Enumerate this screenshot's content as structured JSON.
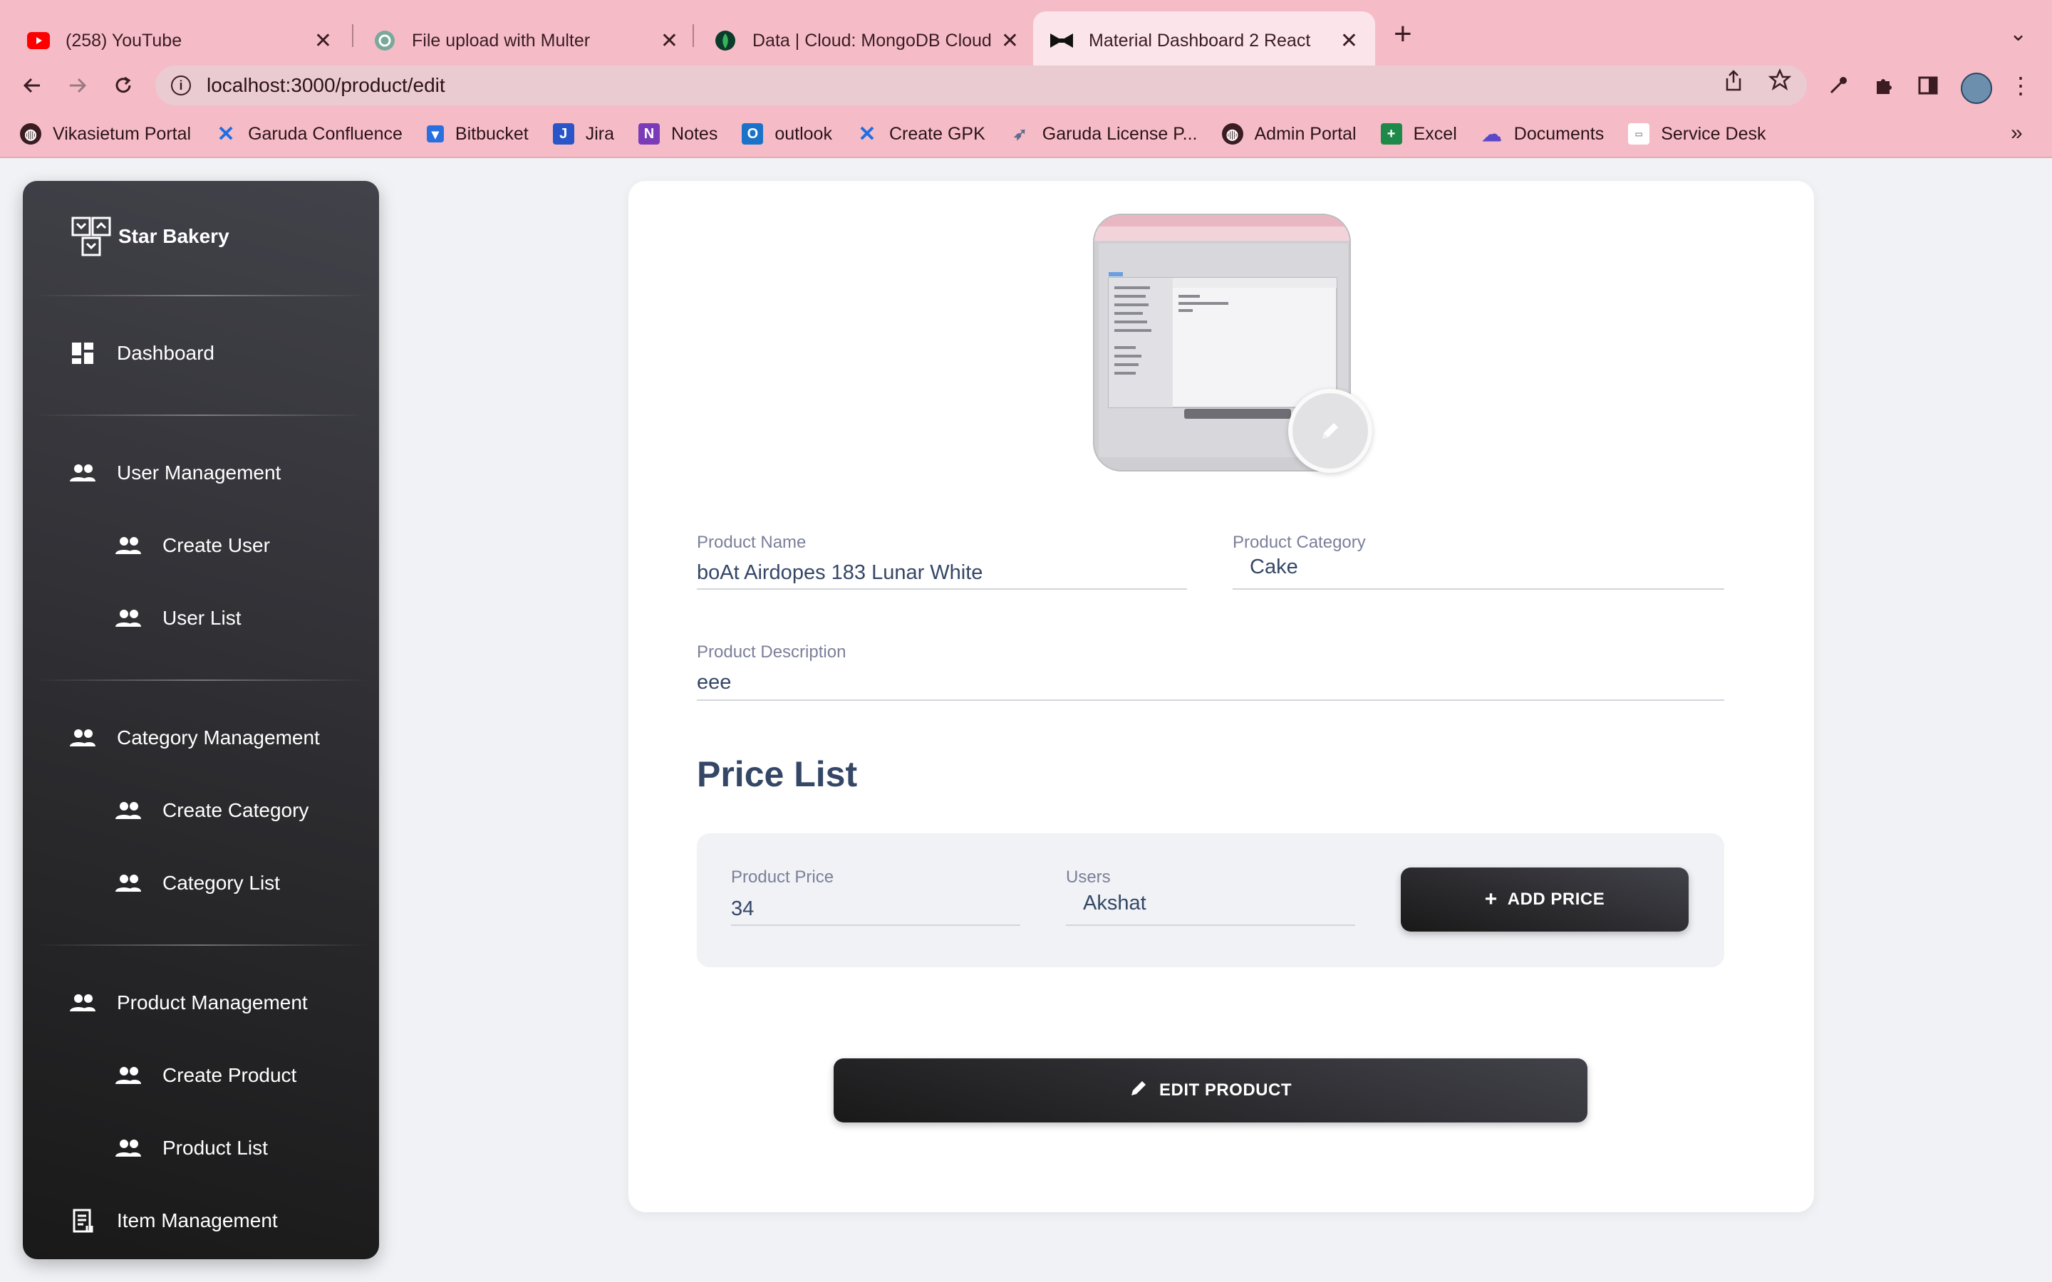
{
  "browser": {
    "tabs": [
      {
        "title": "(258) YouTube",
        "icon": "youtube-icon",
        "active": false
      },
      {
        "title": "File upload with Multer",
        "icon": "chatgpt-icon",
        "active": false
      },
      {
        "title": "Data | Cloud: MongoDB Cloud",
        "icon": "mongodb-leaf-icon",
        "active": false
      },
      {
        "title": "Material Dashboard 2 React",
        "icon": "bow-tie-icon",
        "active": true
      }
    ],
    "url": "localhost:3000/product/edit",
    "bookmarks": [
      {
        "label": "Vikasietum Portal",
        "icon": "globe-icon"
      },
      {
        "label": "Garuda Confluence",
        "icon": "confluence-icon"
      },
      {
        "label": "Bitbucket",
        "icon": "bitbucket-icon"
      },
      {
        "label": "Jira",
        "icon": "jira-icon"
      },
      {
        "label": "Notes",
        "icon": "onenote-icon"
      },
      {
        "label": "outlook",
        "icon": "outlook-icon"
      },
      {
        "label": "Create GPK",
        "icon": "confluence-icon"
      },
      {
        "label": "Garuda License P...",
        "icon": "paper-plane-icon"
      },
      {
        "label": "Admin Portal",
        "icon": "globe-icon"
      },
      {
        "label": "Excel",
        "icon": "excel-icon"
      },
      {
        "label": "Documents",
        "icon": "cloud-docs-icon"
      },
      {
        "label": "Service Desk",
        "icon": "service-desk-icon"
      }
    ]
  },
  "sidebar": {
    "brand": "Star Bakery",
    "items": [
      {
        "label": "Dashboard",
        "icon": "dashboard-icon"
      },
      {
        "label": "User Management",
        "icon": "people-icon"
      },
      {
        "label": "Create User",
        "icon": "people-icon"
      },
      {
        "label": "User List",
        "icon": "people-icon"
      },
      {
        "label": "Category Management",
        "icon": "people-icon"
      },
      {
        "label": "Create Category",
        "icon": "people-icon"
      },
      {
        "label": "Category List",
        "icon": "people-icon"
      },
      {
        "label": "Product Management",
        "icon": "people-icon"
      },
      {
        "label": "Create Product",
        "icon": "people-icon"
      },
      {
        "label": "Product List",
        "icon": "people-icon"
      },
      {
        "label": "Item Management",
        "icon": "receipt-icon"
      }
    ]
  },
  "form": {
    "product_name_label": "Product Name",
    "product_name_value": "boAt Airdopes 183 Lunar White",
    "product_category_label": "Product Category",
    "product_category_value": "Cake",
    "product_description_label": "Product Description",
    "product_description_value": "eee",
    "price_list_title": "Price List",
    "product_price_label": "Product Price",
    "product_price_value": "34",
    "users_label": "Users",
    "users_value": "Akshat",
    "add_price_label": "ADD PRICE",
    "edit_product_label": "EDIT PRODUCT"
  },
  "colors": {
    "chrome": "#f5bcc8",
    "sidebar_gradient_start": "#42424a",
    "sidebar_gradient_end": "#191919",
    "text_primary": "#344767",
    "text_label": "#7b809a",
    "page_bg": "#f0f2f5"
  }
}
